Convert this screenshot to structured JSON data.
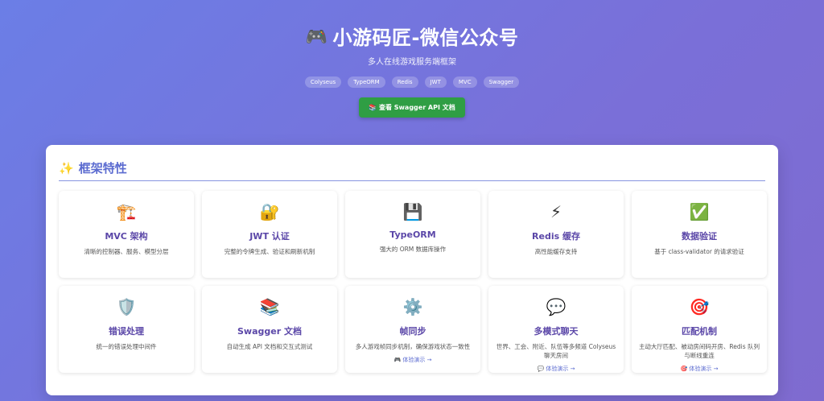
{
  "header": {
    "icon": "🎮",
    "title": "小游码匠-微信公众号",
    "subtitle": "多人在线游戏服务端框架",
    "tags": [
      "Colyseus",
      "TypeORM",
      "Redis",
      "JWT",
      "MVC",
      "Swagger"
    ],
    "swagger_button": "📚 查看 Swagger API 文档"
  },
  "features": {
    "icon": "✨",
    "title": "框架特性",
    "cards": [
      {
        "icon": "🏗️",
        "title": "MVC 架构",
        "desc": "清晰的控制器、服务、模型分层",
        "link": ""
      },
      {
        "icon": "🔐",
        "title": "JWT 认证",
        "desc": "完整的令牌生成、验证和刷新机制",
        "link": ""
      },
      {
        "icon": "💾",
        "title": "TypeORM",
        "desc": "强大的 ORM 数据库操作",
        "link": ""
      },
      {
        "icon": "⚡",
        "title": "Redis 缓存",
        "desc": "高性能缓存支持",
        "link": ""
      },
      {
        "icon": "✅",
        "title": "数据验证",
        "desc": "基于 class-validator 的请求验证",
        "link": ""
      },
      {
        "icon": "🛡️",
        "title": "错误处理",
        "desc": "统一的错误处理中间件",
        "link": ""
      },
      {
        "icon": "📚",
        "title": "Swagger 文档",
        "desc": "自动生成 API 文档和交互式测试",
        "link": ""
      },
      {
        "icon": "⚙️",
        "title": "帧同步",
        "desc": "多人游戏帧同步机制，确保游戏状态一致性",
        "link": "🎮 体验演示 →"
      },
      {
        "icon": "💬",
        "title": "多模式聊天",
        "desc": "世界、工会、附近、队伍等多频道 Colyseus 聊天房间",
        "link": "💬 体验演示 →"
      },
      {
        "icon": "🎯",
        "title": "匹配机制",
        "desc": "主动大厅匹配、被动房间码开房、Redis 队列与断线重连",
        "link": "🎯 体验演示 →"
      }
    ]
  }
}
